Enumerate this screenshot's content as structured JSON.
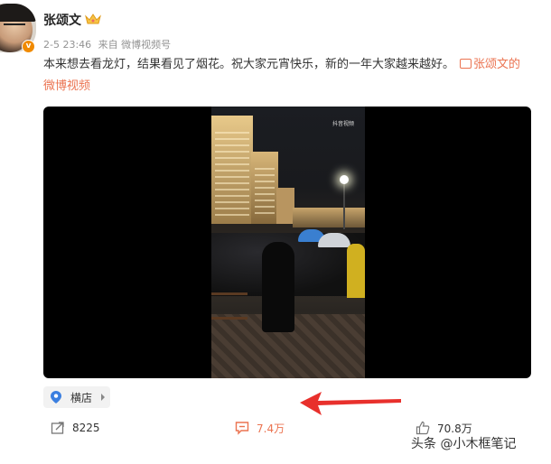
{
  "post": {
    "author": "张颂文",
    "date": "2-5 23:46",
    "source": "来自 微博视频号",
    "text": "本来想去看龙灯，结果看见了烟花。祝大家元宵快乐，新的一年大家越来越好。",
    "video_link": "张颂文的微博视频",
    "location": "横店",
    "verified_badge": "v"
  },
  "video": {
    "watermark": "抖音视频"
  },
  "actions": {
    "forward_count": "8225",
    "comment_count": "7.4万",
    "like_count": "70.8万"
  },
  "attribution": "头条 @小木框笔记",
  "colors": {
    "accent": "#eb7350",
    "badge": "#f08a00",
    "arrow": "#e8302c",
    "location_pin": "#3b7fe0"
  },
  "icons": [
    "crown-icon",
    "video-link-icon",
    "pin-icon",
    "forward-icon",
    "comment-icon",
    "like-icon",
    "toutiao-logo-icon"
  ]
}
